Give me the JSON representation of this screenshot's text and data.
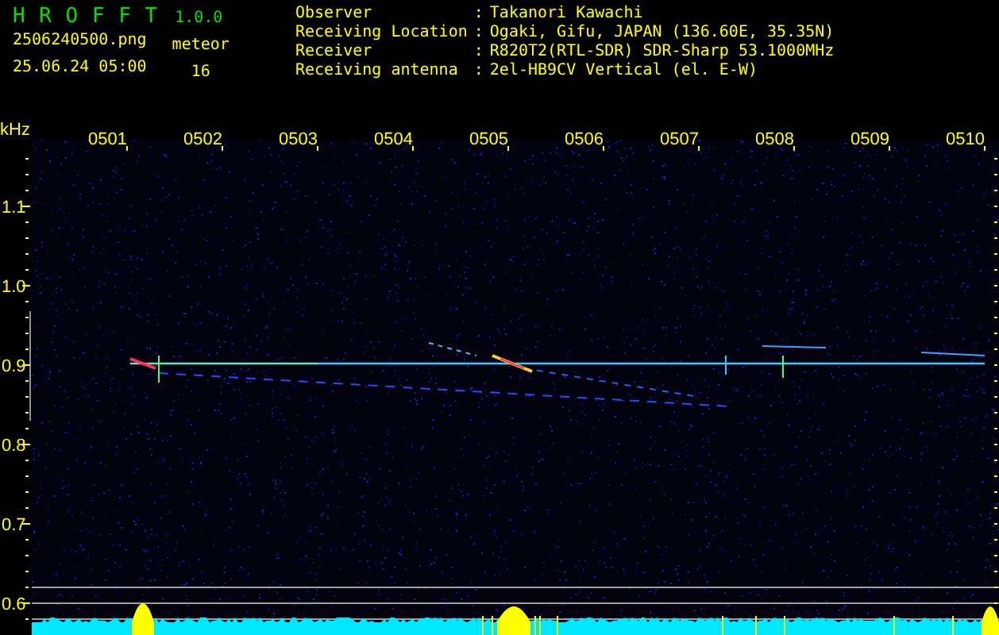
{
  "app": {
    "name": "H R O F F T",
    "version": "1.0.0"
  },
  "file": {
    "name": "2506240500.png",
    "timestamp": "25.06.24 05:00"
  },
  "meteor": {
    "label": "meteor",
    "count": "16"
  },
  "station": [
    {
      "label": "Observer",
      "separator": ":",
      "value": "Takanori Kawachi"
    },
    {
      "label": "Receiving Location",
      "separator": ":",
      "value": "Ogaki, Gifu, JAPAN (136.60E, 35.35N)"
    },
    {
      "label": "Receiver",
      "separator": ":",
      "value": "R820T2(RTL-SDR) SDR-Sharp 53.1000MHz"
    },
    {
      "label": "Receiving antenna",
      "separator": ":",
      "value": "2el-HB9CV Vertical (el. E-W)"
    }
  ],
  "plot": {
    "y_unit": "kHz",
    "y_labels": [
      "1.1",
      "1.0",
      "0.9",
      "0.8",
      "0.7",
      "0.6"
    ],
    "x_labels": [
      "0501",
      "0502",
      "0503",
      "0504",
      "0505",
      "0506",
      "0507",
      "0508",
      "0509",
      "0510"
    ]
  }
}
